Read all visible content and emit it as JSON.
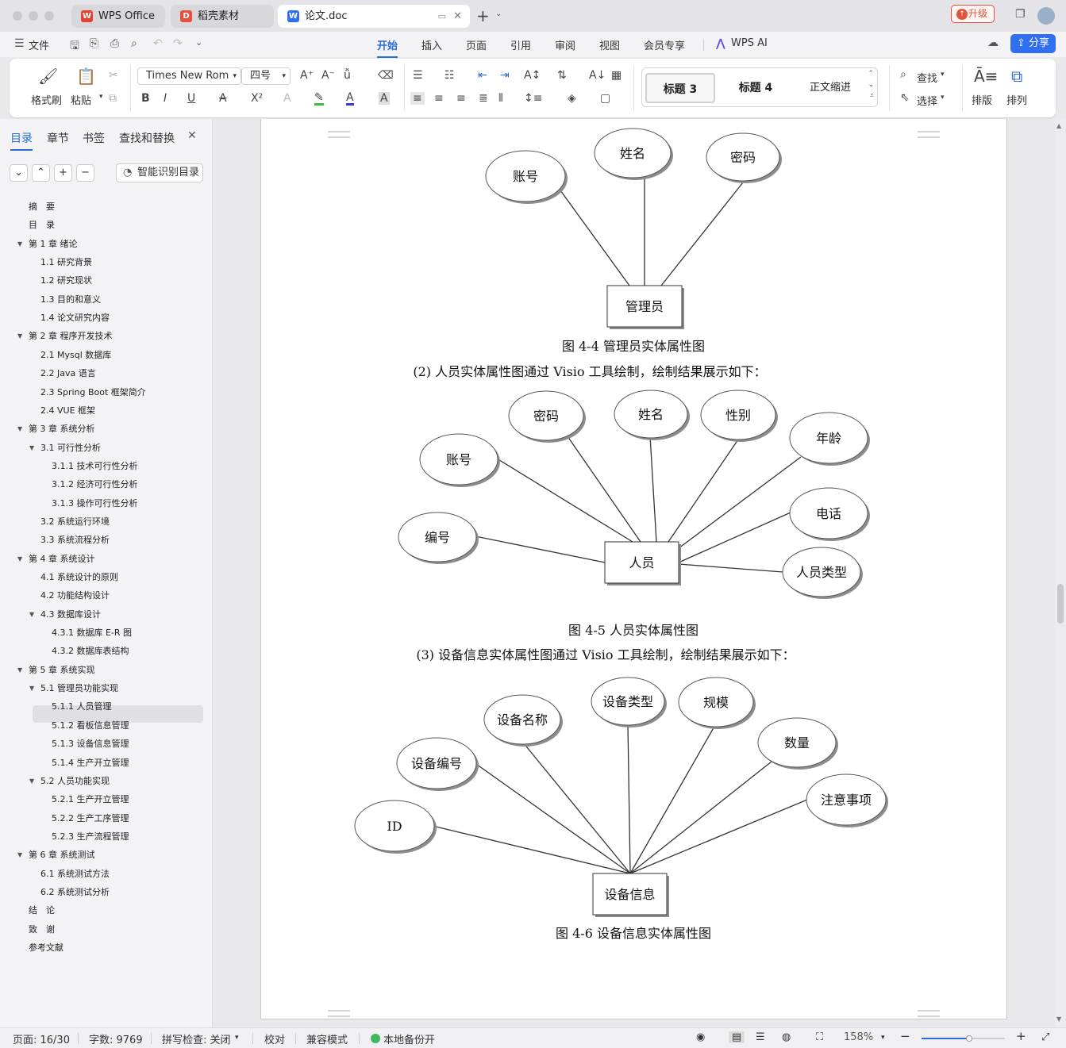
{
  "tabs": [
    {
      "label": "WPS Office",
      "icon": "wps-logo-icon"
    },
    {
      "label": "稻壳素材",
      "icon": "docer-logo-icon"
    },
    {
      "label": "论文.doc",
      "icon": "word-doc-icon"
    }
  ],
  "titlebar": {
    "upgrade_label": "升级"
  },
  "menu": {
    "file_label": "文件",
    "tabs": [
      "开始",
      "插入",
      "页面",
      "引用",
      "审阅",
      "视图",
      "会员专享"
    ],
    "active_tab": "开始",
    "wps_ai_label": "WPS AI",
    "share_label": "分享"
  },
  "ribbon": {
    "format_painter_label": "格式刷",
    "paste_label": "粘贴",
    "font_name": "Times New Rom",
    "font_size": "四号",
    "styles": [
      "标题 3",
      "标题 4",
      "正文缩进"
    ],
    "find_label": "查找",
    "select_label": "选择",
    "layout_label": "排版",
    "arrange_label": "排列"
  },
  "sidebar": {
    "tabs": [
      "目录",
      "章节",
      "书签",
      "查找和替换"
    ],
    "smart_button": "智能识别目录",
    "toc": [
      {
        "text": "摘　要",
        "level": 0
      },
      {
        "text": "目　录",
        "level": 0
      },
      {
        "text": "第 1 章  绪论",
        "level": 0,
        "expand": true
      },
      {
        "text": "1.1  研究背景",
        "level": 1
      },
      {
        "text": "1.2  研究现状",
        "level": 1
      },
      {
        "text": "1.3  目的和意义",
        "level": 1
      },
      {
        "text": "1.4  论文研究内容",
        "level": 1
      },
      {
        "text": "第 2 章  程序开发技术",
        "level": 0,
        "expand": true
      },
      {
        "text": "2.1 Mysql 数据库",
        "level": 1
      },
      {
        "text": "2.2 Java 语言",
        "level": 1
      },
      {
        "text": "2.3 Spring Boot 框架简介",
        "level": 1
      },
      {
        "text": "2.4 VUE 框架",
        "level": 1
      },
      {
        "text": "第 3 章  系统分析",
        "level": 0,
        "expand": true
      },
      {
        "text": "3.1 可行性分析",
        "level": 1,
        "expand": true
      },
      {
        "text": "3.1.1 技术可行性分析",
        "level": 2
      },
      {
        "text": "3.1.2 经济可行性分析",
        "level": 2
      },
      {
        "text": "3.1.3 操作可行性分析",
        "level": 2
      },
      {
        "text": "3.2 系统运行环境",
        "level": 1
      },
      {
        "text": "3.3 系统流程分析",
        "level": 1
      },
      {
        "text": "第 4 章  系统设计",
        "level": 0,
        "expand": true
      },
      {
        "text": "4.1  系统设计的原则",
        "level": 1
      },
      {
        "text": "4.2  功能结构设计",
        "level": 1
      },
      {
        "text": "4.3  数据库设计",
        "level": 1,
        "expand": true
      },
      {
        "text": "4.3.1  数据库 E-R 图",
        "level": 2,
        "selected": true
      },
      {
        "text": "4.3.2  数据库表结构",
        "level": 2
      },
      {
        "text": "第 5 章  系统实现",
        "level": 0,
        "expand": true
      },
      {
        "text": "5.1 管理员功能实现",
        "level": 1,
        "expand": true
      },
      {
        "text": "5.1.1  人员管理",
        "level": 2
      },
      {
        "text": "5.1.2  看板信息管理",
        "level": 2
      },
      {
        "text": "5.1.3  设备信息管理",
        "level": 2
      },
      {
        "text": "5.1.4  生产开立管理",
        "level": 2
      },
      {
        "text": "5.2  人员功能实现",
        "level": 1,
        "expand": true
      },
      {
        "text": "5.2.1  生产开立管理",
        "level": 2
      },
      {
        "text": "5.2.2  生产工序管理",
        "level": 2
      },
      {
        "text": "5.2.3  生产流程管理",
        "level": 2
      },
      {
        "text": "第 6 章  系统测试",
        "level": 0,
        "expand": true
      },
      {
        "text": "6.1 系统测试方法",
        "level": 1
      },
      {
        "text": "6.2  系统测试分析",
        "level": 1
      },
      {
        "text": "结　论",
        "level": 0
      },
      {
        "text": "致　谢",
        "level": 0
      },
      {
        "text": "参考文献",
        "level": 0
      }
    ]
  },
  "document": {
    "diagrams": [
      {
        "entity": "管理员",
        "attributes": [
          "账号",
          "姓名",
          "密码"
        ],
        "caption": "图 4-4  管理员实体属性图"
      },
      {
        "intro": "(2)  人员实体属性图通过 Visio 工具绘制，绘制结果展示如下：",
        "entity": "人员",
        "attributes": [
          "账号",
          "密码",
          "姓名",
          "性别",
          "年龄",
          "编号",
          "电话",
          "人员类型"
        ],
        "caption": "图 4-5  人员实体属性图"
      },
      {
        "intro": "(3)  设备信息实体属性图通过 Visio 工具绘制，绘制结果展示如下：",
        "entity": "设备信息",
        "attributes": [
          "设备编号",
          "设备名称",
          "设备类型",
          "规模",
          "数量",
          "ID",
          "注意事项"
        ],
        "caption": "图 4-6  设备信息实体属性图"
      }
    ]
  },
  "statusbar": {
    "page": "页面: 16/30",
    "words": "字数: 9769",
    "spellcheck": "拼写检查: 关闭",
    "proofread": "校对",
    "compat": "兼容模式",
    "backup": "本地备份开",
    "zoom": "158%"
  },
  "colors": {
    "accent": "#2a6dd8",
    "share_bg": "#2f6ff0",
    "upgrade": "#e2533b",
    "backup_dot": "#3dbb5c"
  }
}
